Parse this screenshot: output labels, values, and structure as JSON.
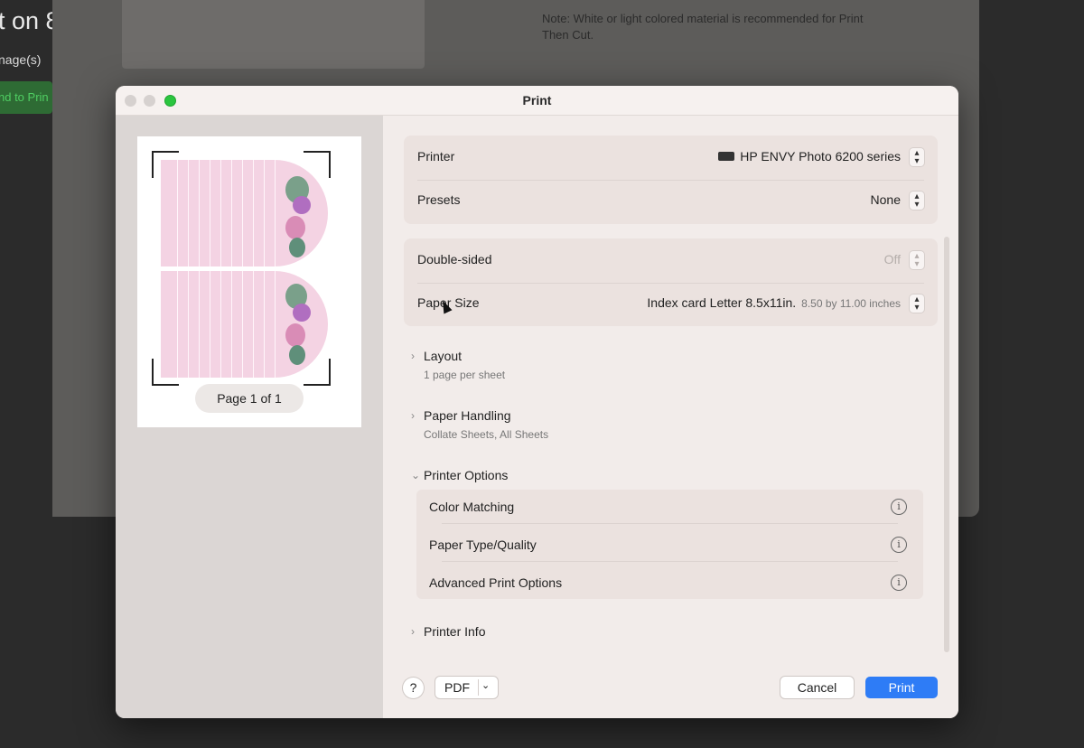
{
  "background_app": {
    "title_fragment": "t on 8",
    "subtitle_fragment": "nage(s)",
    "button_fragment": "nd to Prin",
    "note": "Note: White or light colored material is recommended for Print Then Cut."
  },
  "dialog": {
    "title": "Print",
    "preview": {
      "page_indicator": "Page 1 of 1"
    },
    "printer": {
      "label": "Printer",
      "value": "HP ENVY Photo 6200 series",
      "icon": "printer-icon"
    },
    "presets": {
      "label": "Presets",
      "value": "None"
    },
    "double_sided": {
      "label": "Double-sided",
      "value": "Off"
    },
    "paper_size": {
      "label": "Paper Size",
      "value": "Index card Letter 8.5x11in.",
      "detail": "8.50 by 11.00 inches"
    },
    "sections": [
      {
        "title": "Layout",
        "subtitle": "1 page per sheet",
        "expanded": false
      },
      {
        "title": "Paper Handling",
        "subtitle": "Collate Sheets, All Sheets",
        "expanded": false
      },
      {
        "title": "Printer Options",
        "subtitle": "",
        "expanded": true
      },
      {
        "title": "Printer Info",
        "subtitle": "",
        "expanded": false
      }
    ],
    "printer_options": [
      {
        "label": "Color Matching"
      },
      {
        "label": "Paper Type/Quality"
      },
      {
        "label": "Advanced Print Options"
      }
    ],
    "footer": {
      "help": "?",
      "pdf": "PDF",
      "cancel": "Cancel",
      "print": "Print"
    }
  },
  "colors": {
    "accent": "#2e7cf6",
    "card_pink": "#f4d3e3",
    "maximize_green": "#2ac53f"
  }
}
